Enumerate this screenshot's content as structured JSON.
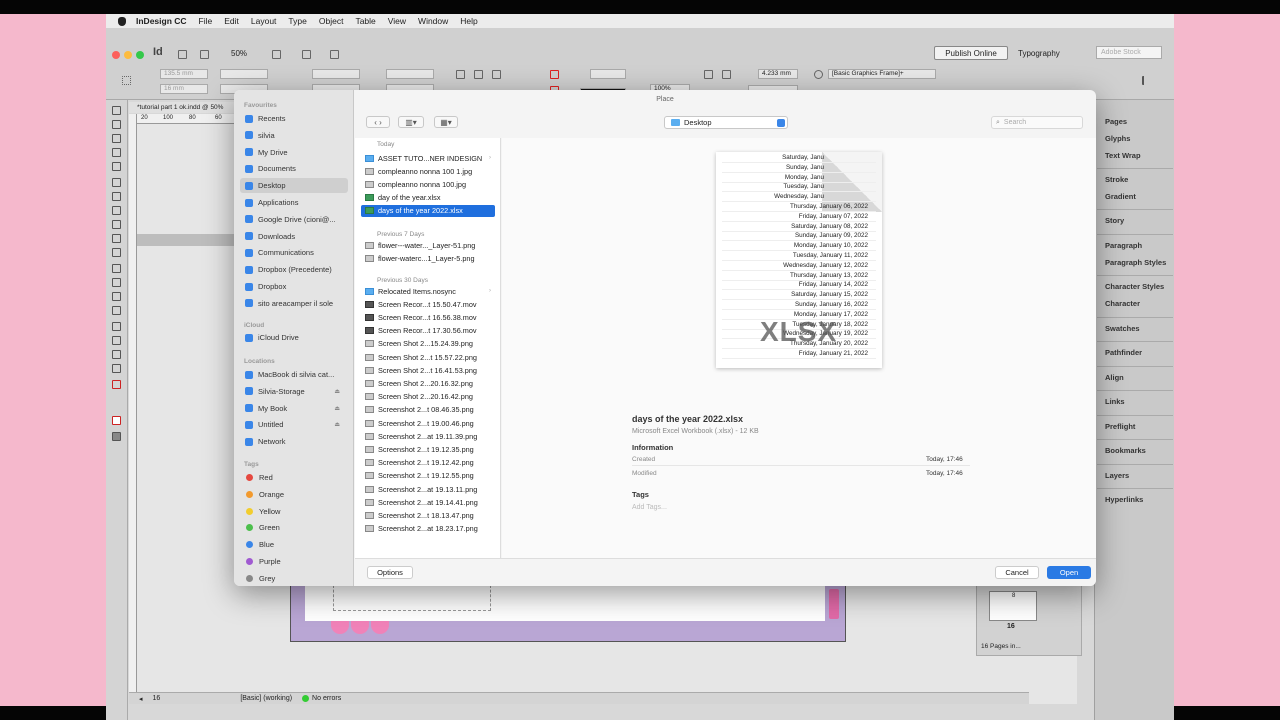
{
  "menubar": {
    "app": "InDesign CC",
    "items": [
      "File",
      "Edit",
      "Layout",
      "Type",
      "Object",
      "Table",
      "View",
      "Window",
      "Help"
    ]
  },
  "app": {
    "logo": "Id",
    "zoom": "50%",
    "publish_label": "Publish Online",
    "workspace": "Typography",
    "stock_placeholder": "Adobe Stock",
    "x_value": "135.5 mm",
    "y_value": "16 mm",
    "stroke_weight": "4.233 mm",
    "opacity": "100%",
    "frame_style": "[Basic Graphics Frame]+",
    "doc_tab": "*tutorial part 1 ok.indd @ 50%",
    "ruler_marks": [
      "20",
      "100",
      "80",
      "60"
    ],
    "status": {
      "page": "16",
      "style": "[Basic] (working)",
      "errors": "No errors"
    },
    "pages_panel": {
      "thumb_num_top": "8",
      "thumb_num": "16",
      "summary": "16 Pages in..."
    }
  },
  "panels": [
    "Pages",
    "Glyphs",
    "Text Wrap",
    "Stroke",
    "Gradient",
    "Story",
    "Paragraph",
    "Paragraph Styles",
    "Character Styles",
    "Character",
    "Swatches",
    "Pathfinder",
    "Align",
    "Links",
    "Preflight",
    "Bookmarks",
    "Layers",
    "Hyperlinks"
  ],
  "dialog": {
    "title": "Place",
    "location": "Desktop",
    "search_placeholder": "Search",
    "sidebar": {
      "favorites_header": "Favourites",
      "favorites": [
        {
          "label": "Recents",
          "icon": "clock-icon"
        },
        {
          "label": "silvia",
          "icon": "home-icon"
        },
        {
          "label": "My Drive",
          "icon": "drive-icon"
        },
        {
          "label": "Documents",
          "icon": "document-icon"
        },
        {
          "label": "Desktop",
          "icon": "desktop-icon"
        },
        {
          "label": "Applications",
          "icon": "applications-icon"
        },
        {
          "label": "Google Drive (cioni@...",
          "icon": "drive-icon"
        },
        {
          "label": "Downloads",
          "icon": "download-icon"
        },
        {
          "label": "Communications",
          "icon": "folder-icon"
        },
        {
          "label": "Dropbox (Precedente)",
          "icon": "folder-icon"
        },
        {
          "label": "Dropbox",
          "icon": "folder-icon"
        },
        {
          "label": "sito areacamper il sole",
          "icon": "folder-icon"
        }
      ],
      "icloud_header": "iCloud",
      "icloud": [
        {
          "label": "iCloud Drive",
          "icon": "cloud-icon"
        }
      ],
      "locations_header": "Locations",
      "locations": [
        {
          "label": "MacBook di silvia cat...",
          "icon": "laptop-icon"
        },
        {
          "label": "Silvia-Storage",
          "icon": "disk-icon"
        },
        {
          "label": "My Book",
          "icon": "disk-icon"
        },
        {
          "label": "Untitled",
          "icon": "disk-icon"
        },
        {
          "label": "Network",
          "icon": "network-icon"
        }
      ],
      "eject_glyph": "⏏",
      "tags_header": "Tags",
      "tags": [
        {
          "label": "Red",
          "color": "#e5483f"
        },
        {
          "label": "Orange",
          "color": "#f29a2e"
        },
        {
          "label": "Yellow",
          "color": "#f2cd2e"
        },
        {
          "label": "Green",
          "color": "#4cbf4c"
        },
        {
          "label": "Blue",
          "color": "#3a86e8"
        },
        {
          "label": "Purple",
          "color": "#a05ad1"
        },
        {
          "label": "Grey",
          "color": "#888888"
        }
      ]
    },
    "sections": {
      "today": "Today",
      "prev7": "Previous 7 Days",
      "prev30": "Previous 30 Days"
    },
    "files_today": [
      {
        "name": "ASSET TUTO...NER INDESIGN",
        "type": "folder"
      },
      {
        "name": "compleanno nonna 100 1.jpg",
        "type": "img"
      },
      {
        "name": "compleanno nonna 100.jpg",
        "type": "img"
      },
      {
        "name": "day of the year.xlsx",
        "type": "xl"
      },
      {
        "name": "days of the year 2022.xlsx",
        "type": "xl"
      }
    ],
    "files_prev7": [
      {
        "name": "flower---water..._Layer-51.png",
        "type": "img"
      },
      {
        "name": "flower-waterc...1_Layer-5.png",
        "type": "img"
      }
    ],
    "files_prev30": [
      {
        "name": "Relocated Items.nosync",
        "type": "folder"
      },
      {
        "name": "Screen Recor...t 15.50.47.mov",
        "type": "mov"
      },
      {
        "name": "Screen Recor...t 16.56.38.mov",
        "type": "mov"
      },
      {
        "name": "Screen Recor...t 17.30.56.mov",
        "type": "mov"
      },
      {
        "name": "Screen Shot 2...15.24.39.png",
        "type": "img"
      },
      {
        "name": "Screen Shot 2...t 15.57.22.png",
        "type": "img"
      },
      {
        "name": "Screen Shot 2...t 16.41.53.png",
        "type": "img"
      },
      {
        "name": "Screen Shot 2...20.16.32.png",
        "type": "img"
      },
      {
        "name": "Screen Shot 2...20.16.42.png",
        "type": "img"
      },
      {
        "name": "Screenshot 2...t 08.46.35.png",
        "type": "img"
      },
      {
        "name": "Screenshot 2...t 19.00.46.png",
        "type": "img"
      },
      {
        "name": "Screenshot 2...at 19.11.39.png",
        "type": "img"
      },
      {
        "name": "Screenshot 2...t 19.12.35.png",
        "type": "img"
      },
      {
        "name": "Screenshot 2...t 19.12.42.png",
        "type": "img"
      },
      {
        "name": "Screenshot 2...t 19.12.55.png",
        "type": "img"
      },
      {
        "name": "Screenshot 2...at 19.13.11.png",
        "type": "img"
      },
      {
        "name": "Screenshot 2...at 19.14.41.png",
        "type": "img"
      },
      {
        "name": "Screenshot 2...t 18.13.47.png",
        "type": "img"
      },
      {
        "name": "Screenshot 2...at 18.23.17.png",
        "type": "img"
      }
    ],
    "preview": {
      "doc_lines": [
        "Saturday, Janu",
        "Sunday, Janu",
        "Monday, Janu",
        "Tuesday, Janu",
        "Wednesday, Janu",
        "Thursday, January 06, 2022",
        "Friday, January 07, 2022",
        "Saturday, January 08, 2022",
        "Sunday, January 09, 2022",
        "Monday, January 10, 2022",
        "Tuesday, January 11, 2022",
        "Wednesday, January 12, 2022",
        "Thursday, January 13, 2022",
        "Friday, January 14, 2022",
        "Saturday, January 15, 2022",
        "Sunday, January 16, 2022",
        "Monday, January 17, 2022",
        "Tuesday, January 18, 2022",
        "Wednesday, January 19, 2022",
        "Thursday, January 20, 2022",
        "Friday, January 21, 2022"
      ],
      "badge": "XLSX",
      "filename": "days of the year 2022.xlsx",
      "kind": "Microsoft Excel Workbook (.xlsx) - 12 KB",
      "info_header": "Information",
      "created_label": "Created",
      "created_value": "Today, 17:46",
      "modified_label": "Modified",
      "modified_value": "Today, 17:46",
      "tags_header": "Tags",
      "tags_placeholder": "Add Tags..."
    },
    "buttons": {
      "options": "Options",
      "cancel": "Cancel",
      "open": "Open"
    },
    "accent": "#1f6fde"
  }
}
